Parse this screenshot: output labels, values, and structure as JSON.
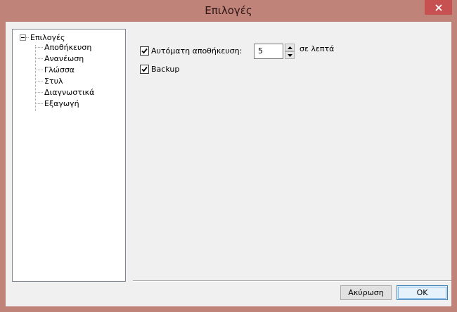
{
  "window": {
    "title": "Επιλογές",
    "colors": {
      "frame": "#c0837a",
      "client": "#f0f0f0",
      "close": "#c75050"
    }
  },
  "tree": {
    "root_label": "Επιλογές",
    "root_expanded": true,
    "items": [
      {
        "label": "Αποθήκευση"
      },
      {
        "label": "Ανανέωση"
      },
      {
        "label": "Γλώσσα"
      },
      {
        "label": "Στυλ"
      },
      {
        "label": "Διαγνωστικά"
      },
      {
        "label": "Εξαγωγή"
      }
    ]
  },
  "settings": {
    "autosave": {
      "label": "Αυτόματη αποθήκευση:",
      "checked": true
    },
    "autosave_interval": {
      "value": "5",
      "units": "σε λεπτά"
    },
    "backup": {
      "label": "Backup",
      "checked": true
    }
  },
  "buttons": {
    "cancel_label": "Ακύρωση",
    "ok_label": "OK"
  }
}
